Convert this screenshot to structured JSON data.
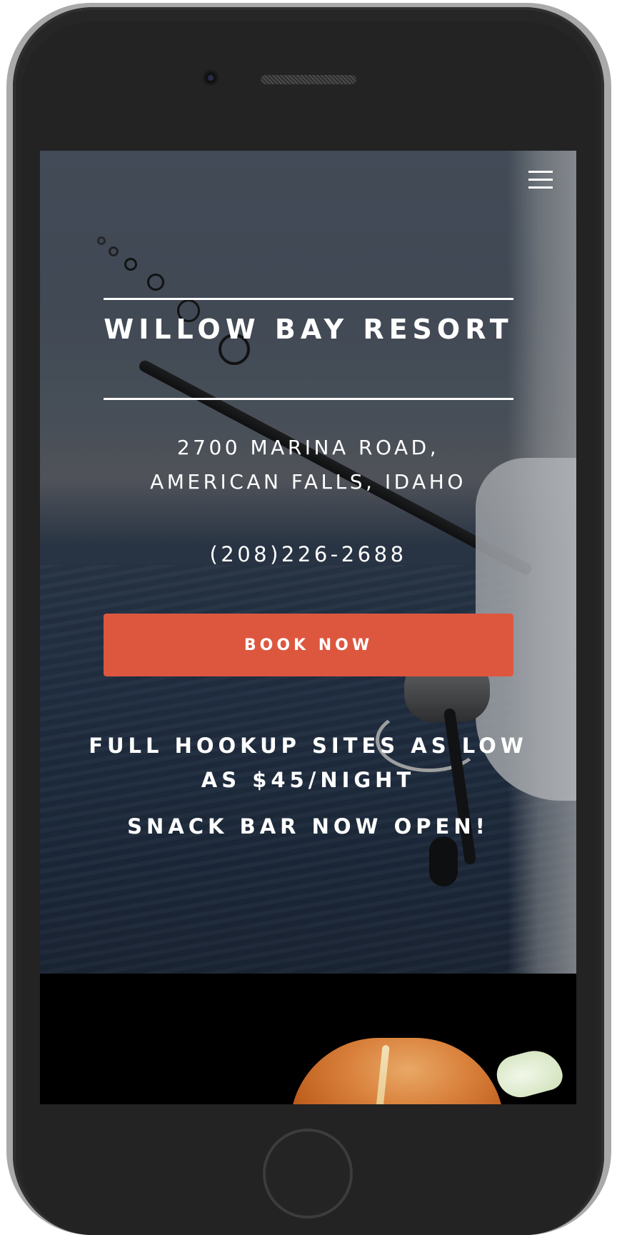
{
  "header": {
    "menu_icon": "hamburger-menu-icon"
  },
  "hero": {
    "title": "WILLOW BAY RESORT",
    "address_line_1": "2700 MARINA ROAD,",
    "address_line_2": "AMERICAN FALLS, IDAHO",
    "phone": "(208)226-2688",
    "book_label": "BOOK NOW",
    "promo_1": "FULL HOOKUP SITES AS LOW AS $45/NIGHT",
    "promo_2": "SNACK BAR NOW OPEN!"
  },
  "colors": {
    "accent": "#dd573f",
    "text": "#ffffff",
    "frame": "#262626"
  }
}
